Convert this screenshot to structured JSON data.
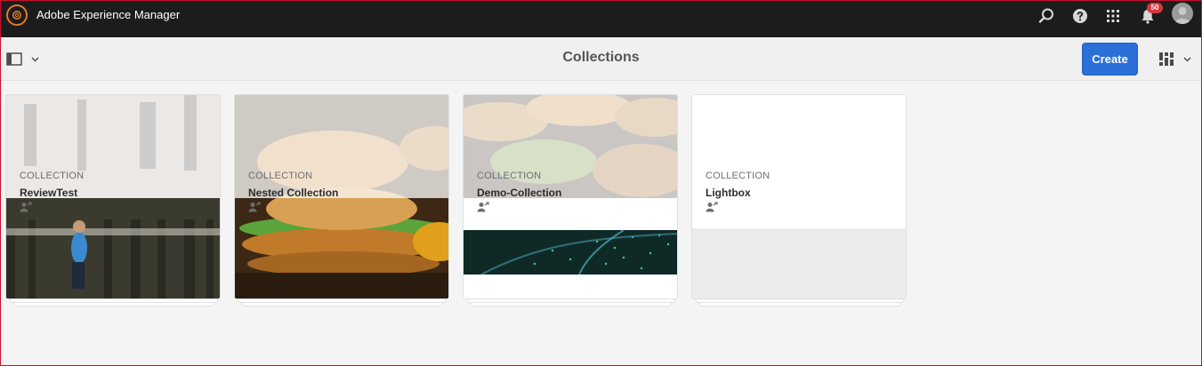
{
  "shell": {
    "app_title": "Adobe Experience Manager",
    "notification_count": "50",
    "brand_color": "#e07b2a",
    "icons": [
      "search-icon",
      "help-icon",
      "solutions-grid-icon",
      "bell-icon",
      "user-avatar"
    ]
  },
  "actionbar": {
    "page_title": "Collections",
    "create_label": "Create",
    "accent_color": "#2b6fd8",
    "icons": [
      "rail-toggle-icon",
      "chevron-down-icon",
      "card-view-icon"
    ]
  },
  "cards": [
    {
      "type": "COLLECTION",
      "title": "ReviewTest",
      "thumbnail": "forest-runner"
    },
    {
      "type": "COLLECTION",
      "title": "Nested Collection",
      "thumbnail": "burger"
    },
    {
      "type": "COLLECTION",
      "title": "Demo-Collection",
      "thumbnail": "burgers-and-particles"
    },
    {
      "type": "COLLECTION",
      "title": "Lightbox",
      "thumbnail": "empty"
    }
  ]
}
